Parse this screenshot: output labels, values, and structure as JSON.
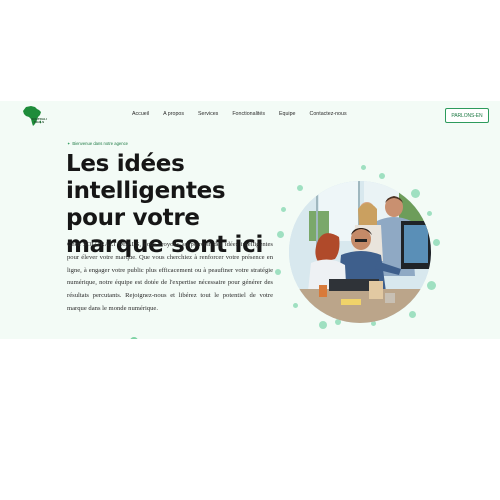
{
  "header": {
    "logo_text": "SOUTRALI DEALS",
    "nav": [
      "Accueil",
      "A propos",
      "Services",
      "Fonctionalités",
      "Equipe",
      "Contactez-nous"
    ],
    "cta_label": "PARLONS-EN"
  },
  "hero": {
    "welcome": "Bienvenue dans notre agence",
    "title": "Les idées intelligentes pour votre marque sont ici",
    "description": "Chez SOUTRALI DEALS, nous croyons au pouvoir des idées intelligentes pour élever votre marque. Que vous cherchiez à renforcer votre présence en ligne, à engager votre public plus efficacement ou à peaufiner votre stratégie numérique, notre équipe est dotée de l'expertise nécessaire pour générer des résultats percutants. Rejoignez-nous et libérez tout le potentiel de votre marque dans le monde numérique."
  },
  "colors": {
    "accent": "#2d9b5c",
    "background": "#f3fbf6",
    "dots": "#9fe0c1"
  },
  "icons": {
    "logo": "africa-map-icon",
    "welcome": "sparkle-icon"
  }
}
